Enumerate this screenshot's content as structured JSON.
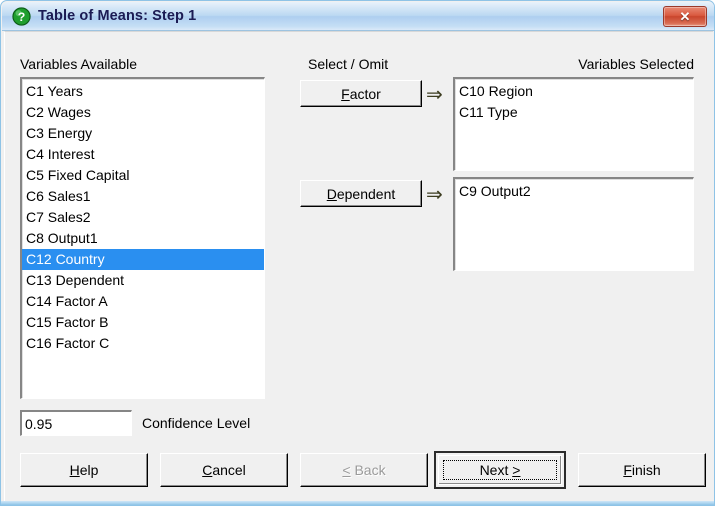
{
  "window": {
    "title": "Table of Means: Step 1",
    "title_icon": "question-mark-icon",
    "close_label": "✕",
    "accent_title_color": "#1b1b53",
    "titlebar_color": "#aecef0",
    "close_button_color": "#c9452c",
    "selection_color": "#2a8ff0"
  },
  "available": {
    "label": "Variables Available",
    "items": [
      {
        "text": "C1 Years",
        "selected": false
      },
      {
        "text": "C2 Wages",
        "selected": false
      },
      {
        "text": "C3 Energy",
        "selected": false
      },
      {
        "text": "C4 Interest",
        "selected": false
      },
      {
        "text": "C5 Fixed Capital",
        "selected": false
      },
      {
        "text": "C6 Sales1",
        "selected": false
      },
      {
        "text": "C7 Sales2",
        "selected": false
      },
      {
        "text": "C8 Output1",
        "selected": false
      },
      {
        "text": "C12 Country",
        "selected": true
      },
      {
        "text": "C13 Dependent",
        "selected": false
      },
      {
        "text": "C14 Factor A",
        "selected": false
      },
      {
        "text": "C15 Factor B",
        "selected": false
      },
      {
        "text": "C16 Factor C",
        "selected": false
      }
    ]
  },
  "select_omit": {
    "label": "Select / Omit",
    "factor_button": {
      "accel": "F",
      "rest": "actor"
    },
    "dependent_button": {
      "accel": "D",
      "rest": "ependent"
    },
    "arrow": "⇒"
  },
  "selected_panel": {
    "label": "Variables Selected",
    "factor_items": [
      "C10 Region",
      "C11 Type"
    ],
    "dependent_items": [
      "C9 Output2"
    ]
  },
  "confidence": {
    "value": "0.95",
    "placeholder": "",
    "label": "Confidence Level"
  },
  "buttons": {
    "help": {
      "accel": "H",
      "before": "",
      "rest": "elp",
      "disabled": false,
      "default": false
    },
    "cancel": {
      "accel": "C",
      "before": "",
      "rest": "ancel",
      "disabled": false,
      "default": false
    },
    "back": {
      "accel": "<",
      "before": "",
      "rest": " Back",
      "disabled": true,
      "default": false
    },
    "next": {
      "accel": ">",
      "before": "Next ",
      "rest": "",
      "disabled": false,
      "default": true
    },
    "finish": {
      "accel": "F",
      "before": "",
      "rest": "inish",
      "disabled": false,
      "default": false
    }
  }
}
